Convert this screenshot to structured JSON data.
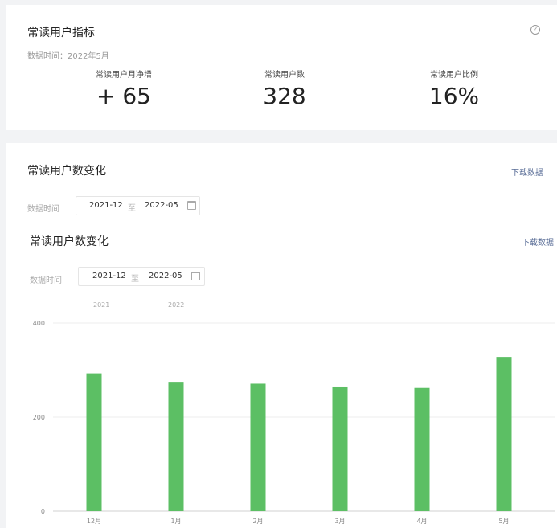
{
  "metrics_card": {
    "title": "常读用户指标",
    "data_time": "数据时间：2022年5月",
    "help_icon": "?",
    "items": [
      {
        "label": "常读用户月净增",
        "value": "+ 65"
      },
      {
        "label": "常读用户数",
        "value": "328"
      },
      {
        "label": "常读用户比例",
        "value": "16%"
      }
    ]
  },
  "change_card": {
    "title": "常读用户数变化",
    "download": "下载数据",
    "time_label": "数据时间",
    "start": "2021-12",
    "to": "至",
    "end": "2022-05"
  },
  "chart_panel": {
    "title": "常读用户数变化",
    "download": "下载数据",
    "time_label": "数据时间",
    "start": "2021-12",
    "to": "至",
    "end": "2022-05",
    "year_labels": [
      "2021",
      "2022"
    ]
  },
  "chart_data": {
    "type": "bar",
    "categories": [
      "12月",
      "1月",
      "2月",
      "3月",
      "4月",
      "5月"
    ],
    "values": [
      293,
      275,
      271,
      265,
      262,
      328
    ],
    "yticks": [
      0,
      200,
      400
    ],
    "ylim": [
      0,
      400
    ],
    "grid": true,
    "bar_color": "#5cbf64"
  }
}
